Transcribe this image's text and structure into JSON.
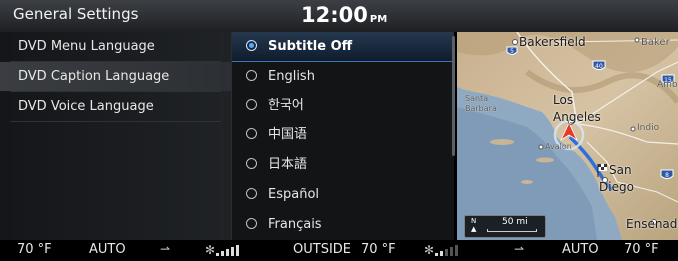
{
  "header": {
    "title": "General Settings",
    "time": "12:00",
    "ampm": "PM"
  },
  "menu": {
    "items": [
      {
        "label": "DVD Menu Language",
        "selected": false
      },
      {
        "label": "DVD Caption Language",
        "selected": true
      },
      {
        "label": "DVD Voice Language",
        "selected": false
      }
    ]
  },
  "options": {
    "items": [
      {
        "label": "Subtitle Off",
        "selected": true
      },
      {
        "label": "English",
        "selected": false
      },
      {
        "label": "한국어",
        "selected": false
      },
      {
        "label": "中国语",
        "selected": false
      },
      {
        "label": "日本語",
        "selected": false
      },
      {
        "label": "Español",
        "selected": false
      },
      {
        "label": "Français",
        "selected": false
      }
    ]
  },
  "map": {
    "places": [
      "Bakersfield",
      "Baker",
      "Amb",
      "Santa",
      "Barbara",
      "Los",
      "Angeles",
      "Indio",
      "Avalon",
      "San",
      "Diego",
      "Ensenada"
    ],
    "highway_shields": [
      "5",
      "40",
      "15",
      "8"
    ],
    "scale": {
      "north": "N",
      "distance": "50 mi"
    }
  },
  "climate": {
    "left_temp": "70 °F",
    "left_mode": "AUTO",
    "outside_label": "OUTSIDE",
    "outside_temp": "70 °F",
    "right_mode": "AUTO",
    "right_temp": "70 °F",
    "left_fan_level": 5,
    "right_fan_level": 2
  },
  "colors": {
    "accent": "#3a78b8",
    "radio_on": "#5aa9ff",
    "route": "#2d6fe0",
    "vehicle": "#e23b2a"
  }
}
